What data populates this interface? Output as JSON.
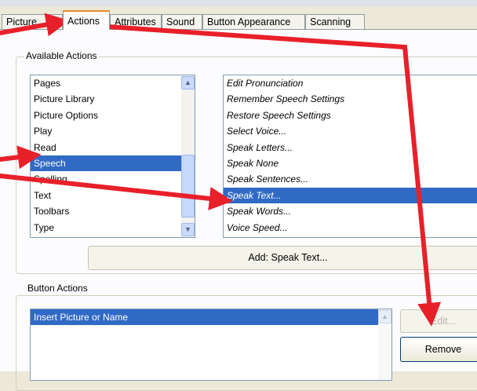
{
  "tabs": [
    "Picture",
    "Actions",
    "Attributes",
    "Sound",
    "Button Appearance",
    "Scanning"
  ],
  "active_tab": "Actions",
  "available_actions": {
    "label": "Available Actions",
    "categories": [
      "Pages",
      "Picture Library",
      "Picture Options",
      "Play",
      "Read",
      "Speech",
      "Spelling",
      "Text",
      "Toolbars",
      "Type"
    ],
    "selected_category": "Speech",
    "actions": [
      "Edit Pronunciation",
      "Remember Speech Settings",
      "Restore Speech Settings",
      "Select Voice...",
      "Speak Letters...",
      "Speak None",
      "Speak Sentences...",
      "Speak Text...",
      "Speak Words...",
      "Voice Speed..."
    ],
    "selected_action": "Speak Text...",
    "add_button": "Add:  Speak Text..."
  },
  "button_actions": {
    "label": "Button Actions",
    "items": [
      "Insert Picture or Name"
    ],
    "selected_item": "Insert Picture or Name",
    "edit_button": "Edit...",
    "remove_button": "Remove"
  },
  "colors": {
    "selection": "#316ac5",
    "annotation_arrow": "#e8202a",
    "active_tab_accent": "#e68b2c"
  }
}
